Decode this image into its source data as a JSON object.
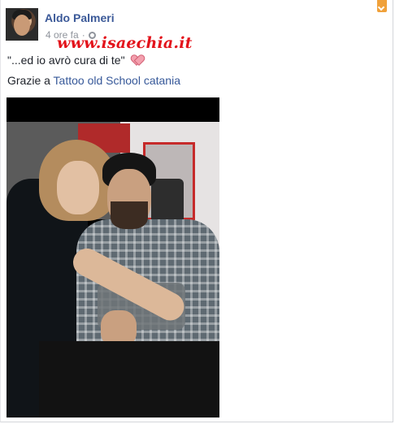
{
  "post": {
    "author_name": "Aldo Palmeri",
    "timestamp": "4 ore fa",
    "privacy_icon": "globe-icon",
    "watermark": "www.isaechia.it",
    "status_text": "\"...ed io avrò cura di te\"",
    "status_emoji": "heart-icon",
    "thanks_prefix": "Grazie a ",
    "thanks_link": "Tattoo old School catania",
    "options_icon": "chevron-down-icon",
    "photo_alt": "post-photo"
  },
  "colors": {
    "link": "#3b5998",
    "meta": "#90949c",
    "watermark": "#e3131b",
    "options_tab": "#f0a13a"
  }
}
